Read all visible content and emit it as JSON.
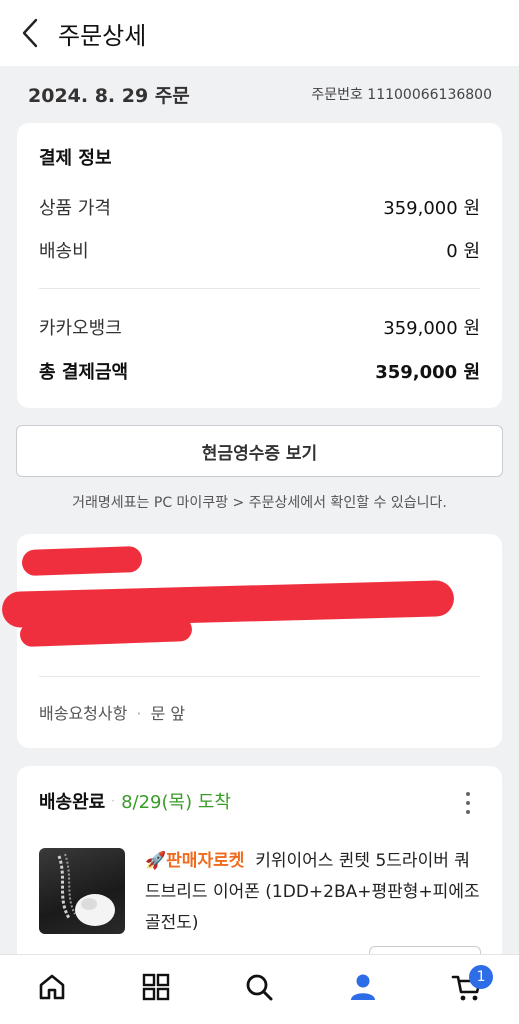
{
  "header": {
    "title": "주문상세"
  },
  "order": {
    "date_label": "2024. 8. 29 주문",
    "number_label": "주문번호 11100066136800"
  },
  "payment": {
    "title": "결제 정보",
    "product_price_label": "상품 가격",
    "product_price": "359,000 원",
    "shipping_label": "배송비",
    "shipping": "0 원",
    "method_label": "카카오뱅크",
    "method_amount": "359,000 원",
    "total_label": "총 결제금액",
    "total": "359,000 원"
  },
  "receipt": {
    "button_label": "현금영수증 보기",
    "notice": "거래명세표는 PC 마이쿠팡 > 주문상세에서 확인할 수 있습니다."
  },
  "delivery_request": {
    "label": "배송요청사항",
    "separator": "·",
    "value": "문 앞"
  },
  "shipment": {
    "status": "배송완료",
    "separator": "·",
    "arrival": "8/29(목) 도착",
    "tag": "판매자로켓",
    "product_name": "키위이어스 퀸텟 5드라이버 쿼드브리드 이어폰 (1DD+2BA+평판형+피에조 골전도)"
  },
  "nav": {
    "items": [
      "home-icon",
      "category-icon",
      "search-icon",
      "my-icon",
      "cart-icon"
    ],
    "cart_badge": "1"
  },
  "colors": {
    "accent": "#2e6de8",
    "status_green": "#3a9b2a",
    "rocket_orange": "#f06b1d",
    "redaction": "#ef2f3e"
  }
}
